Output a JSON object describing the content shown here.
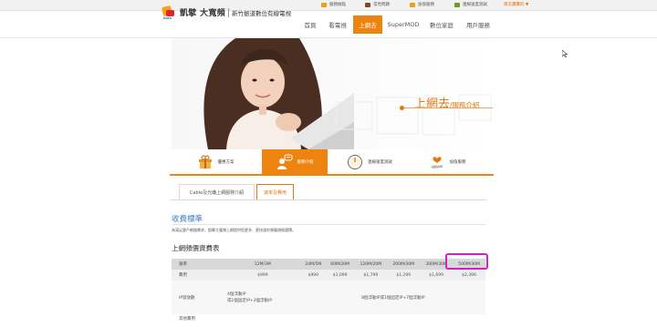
{
  "topbar": {
    "items": [
      {
        "label": "服務據點",
        "color": "#e8a21c"
      },
      {
        "label": "常見問題",
        "color": "#7a4a2a"
      },
      {
        "label": "加值服務",
        "color": "#e8a21c"
      },
      {
        "label": "連線速度測試",
        "color": "#6a9a2a"
      }
    ],
    "link": "南瓜寶寶的 ▼"
  },
  "logo": {
    "brand": "凱擘 大寬頻",
    "tagline": "新竹振道數位有線電視",
    "mark_text": "kbro"
  },
  "nav": {
    "items": [
      "首頁",
      "看電視",
      "上網去",
      "SuperMOD",
      "數位家庭",
      "用戶服務"
    ],
    "active": "上網去"
  },
  "hero": {
    "title": "上網去",
    "subtitle": "/服務介紹"
  },
  "features": {
    "items": [
      "優惠方案",
      "服務介紹",
      "連線速度測試",
      "加值服務"
    ],
    "active": "服務介紹"
  },
  "tabs": {
    "items": [
      "Cable及光纖上網服務介紹",
      "速率及費用"
    ],
    "selected": "速率及費用"
  },
  "section": {
    "title": "收費標準",
    "note": "為滿足客戶網路需求，凱擘大寬頻上網提供您更多、更快速的頻寬規格選擇。",
    "table_title": "上網頻價資費表"
  },
  "price_table": {
    "headers": [
      "速率",
      "12M/3M",
      "24M/5M",
      "60M/20M",
      "120M/20M",
      "200M/30M",
      "300M/30M",
      "500M/30M"
    ],
    "rows": [
      {
        "label": "費用",
        "cells": [
          "$999",
          "$999",
          "$1,099",
          "$1,799",
          "$1,299",
          "$1,699",
          "$2,399"
        ]
      },
      {
        "label": "IP發放數",
        "first": "4個浮動IP\n或1個固定IP+3個浮動IP",
        "merged": "8個浮動IP或1個固定IP+7個浮動IP"
      },
      {
        "label": "其他費用",
        "cells": []
      }
    ],
    "highlight_column": "500M/30M",
    "highlight_color": "#d020c8"
  },
  "colors": {
    "accent": "#ee8410",
    "title_blue": "#3f7fbf"
  }
}
